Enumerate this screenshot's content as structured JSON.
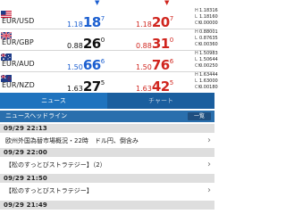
{
  "quotes": [
    {
      "pair": "EUR/USD",
      "flag": "us",
      "bid_arrow": "▼",
      "ask_arrow": "▼",
      "bid_dir": "down",
      "ask_dir": "down",
      "bid": {
        "pre": "1.18",
        "big": "18",
        "sup": "7"
      },
      "ask": {
        "pre": "1.18",
        "big": "20",
        "sup": "7"
      },
      "hlc": [
        "1.18316",
        "1.18160",
        "0.00000"
      ],
      "bid_color": "#1c5fd0",
      "ask_color": "#d0251e"
    },
    {
      "pair": "EUR/GBP",
      "flag": "uk",
      "bid": {
        "pre": "0.88",
        "big": "26",
        "sup": "0"
      },
      "ask": {
        "pre": "0.88",
        "big": "31",
        "sup": "0"
      },
      "hlc": [
        "0.88001",
        "0.87635",
        "0.00360"
      ],
      "bid_color": "#111111",
      "ask_color": "#d0251e"
    },
    {
      "pair": "EUR/AUD",
      "flag": "au",
      "bid": {
        "pre": "1.50",
        "big": "66",
        "sup": "6"
      },
      "ask": {
        "pre": "1.50",
        "big": "76",
        "sup": "6"
      },
      "hlc": [
        "1.50983",
        "1.50644",
        "0.00250"
      ],
      "bid_color": "#1c5fd0",
      "ask_color": "#d0251e"
    },
    {
      "pair": "EUR/NZD",
      "flag": "nz",
      "bid": {
        "pre": "1.63",
        "big": "27",
        "sup": "5"
      },
      "ask": {
        "pre": "1.63",
        "big": "42",
        "sup": "5"
      },
      "hlc": [
        "1.63444",
        "1.63000",
        "0.00180"
      ],
      "bid_color": "#111111",
      "ask_color": "#d0251e"
    }
  ],
  "hlc_labels": [
    "H",
    "L",
    "Ch"
  ],
  "tabs": {
    "news": "ニュース",
    "chart": "チャート"
  },
  "news": {
    "header_title": "ニュースヘッドライン",
    "list_button": "一覧",
    "items": [
      {
        "time": "09/29 22:13",
        "text": "欧州外国為替市場概況・22時　ドル円、倒含み"
      },
      {
        "time": "09/29 22:00",
        "text": "【松のすっとびストラテジー】（2）"
      },
      {
        "time": "09/29 21:50",
        "text": "【松のすっとびストラテジー】"
      },
      {
        "time": "09/29 21:49",
        "text": ""
      }
    ]
  }
}
